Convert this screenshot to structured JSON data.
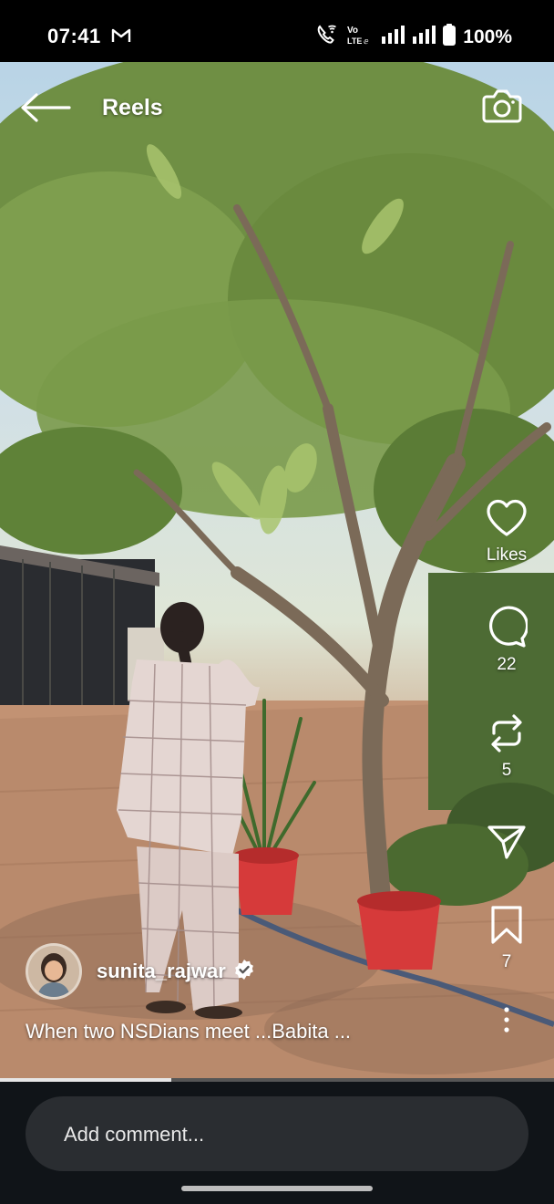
{
  "status_bar": {
    "time": "07:41",
    "network_label": "Vo LTE",
    "battery": "100%",
    "icons": [
      "gmail-icon",
      "wifi-call-icon",
      "volte-icon",
      "signal-icon",
      "signal-icon",
      "battery-icon"
    ]
  },
  "header": {
    "title": "Reels",
    "back_icon": "arrow-left-icon",
    "camera_icon": "camera-icon"
  },
  "actions": {
    "likes_label": "Likes",
    "comments_count": "22",
    "reposts_count": "5",
    "saves_count": "7"
  },
  "post": {
    "username": "sunita_rajwar",
    "verified": true,
    "caption": "When two NSDians meet ...Babita ..."
  },
  "playback": {
    "progress_fraction": 0.31
  },
  "comment": {
    "placeholder": "Add comment..."
  },
  "colors": {
    "background": "#000000",
    "bottom_bar": "#101418",
    "pot_red": "#d63a3a"
  }
}
